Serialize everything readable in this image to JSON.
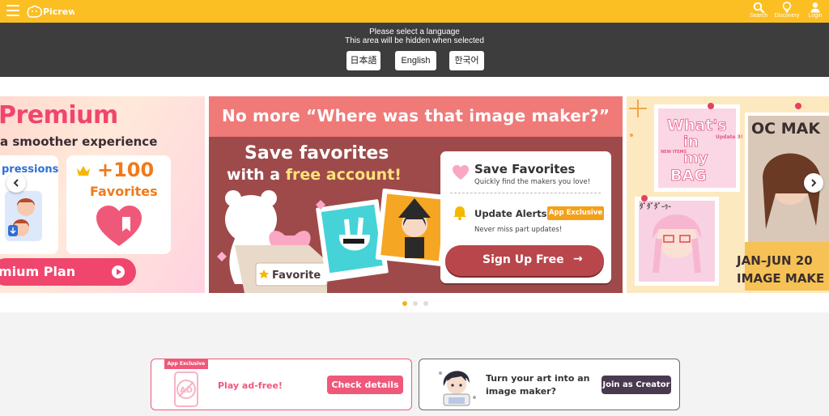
{
  "header": {
    "logo_text": "Picrew",
    "nav": [
      {
        "label": "Search",
        "icon": "search-icon"
      },
      {
        "label": "Discovery",
        "icon": "lightbulb-icon"
      },
      {
        "label": "Login",
        "icon": "user-icon"
      }
    ]
  },
  "language_bar": {
    "line1": "Please select a language",
    "line2": "This area will be hidden when selected",
    "options": [
      "日本語",
      "English",
      "한국어"
    ]
  },
  "carousel": {
    "slide_left": {
      "title": "Premium",
      "subtitle": "a smoother experience",
      "card1_label": "pressions",
      "card2_value": "+100",
      "card2_label": "Favorites",
      "plan_button": "mium Plan"
    },
    "slide_center": {
      "headline": "No more “Where was that image maker?”",
      "save_line1": "Save favorites",
      "save_line2_a": "with a ",
      "save_line2_b": "free account!",
      "favorite_box_label": "Favorite",
      "feature1_title": "Save Favorites",
      "feature1_desc": "Quickly find the makers you love!",
      "feature2_title": "Update Alerts",
      "feature2_badge": "App Exclusive",
      "feature2_desc": "Never miss part updates!",
      "signup_button": "Sign Up Free",
      "signup_arrow": "→"
    },
    "slide_right": {
      "sticker1_line1": "What's",
      "sticker1_line2": "in",
      "sticker1_line3": "my",
      "sticker1_line4": "BAG",
      "sticker1_new": "NEW ITEMS",
      "sticker1_update": "Update 3!",
      "title_top": "OC MAK",
      "title_line1": "JAN–JUN 20",
      "title_line2": "IMAGE MAKE"
    },
    "dots": 3,
    "active_dot": 0
  },
  "bottom_banners": {
    "left": {
      "badge": "App Exclusive",
      "ad_text": "AD",
      "text": "Play ad-free!",
      "button": "Check details"
    },
    "right": {
      "text_line1": "Turn your art into an",
      "text_line2": "image maker?",
      "button": "Join as Creator"
    }
  },
  "colors": {
    "header_bg": "#fbbf24",
    "language_bar_bg": "#3d3d3d",
    "accent_pink": "#f0587a",
    "center_slide_bg": "#9e4a4a",
    "signup_button": "#b9464a",
    "creator_button": "#4a3a4f"
  }
}
